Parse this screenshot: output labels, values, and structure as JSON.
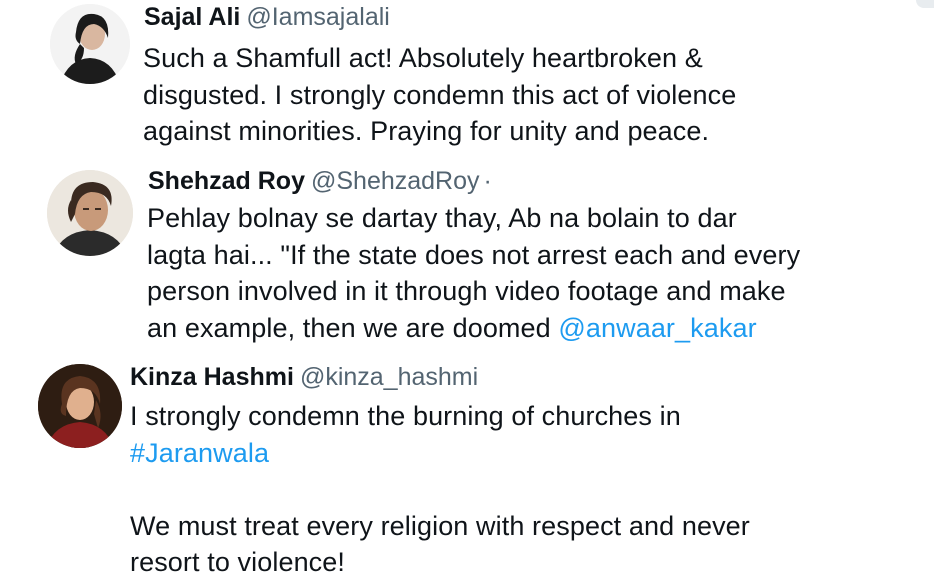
{
  "tweets": [
    {
      "name": "Sajal Ali",
      "handle": "@Iamsajalali",
      "lines": [
        "Such a Shamfull act! Absolutely heartbroken &",
        "disgusted. I strongly condemn this act of violence",
        "against minorities. Praying for unity and peace."
      ],
      "avatar": "profile-photo"
    },
    {
      "name": "Shehzad Roy",
      "handle": "@ShehzadRoy",
      "separator": "·",
      "lines": [
        "Pehlay bolnay se dartay thay, Ab na bolain to dar",
        "lagta hai... \"If the state does not arrest each and every",
        "person involved in it through video footage and make",
        "an example, then we are doomed "
      ],
      "mention": "@anwaar_kakar",
      "avatar": "profile-photo"
    },
    {
      "name": "Kinza Hashmi",
      "handle": "@kinza_hashmi",
      "lines": [
        "I strongly condemn the burning of churches in"
      ],
      "hashtag": "#Jaranwala",
      "lines2": [
        "We must treat every religion with respect and never",
        "resort to violence!"
      ],
      "avatar": "profile-photo"
    }
  ],
  "colors": {
    "text": "#0f1419",
    "secondary": "#536471",
    "link": "#1d9bf0"
  }
}
